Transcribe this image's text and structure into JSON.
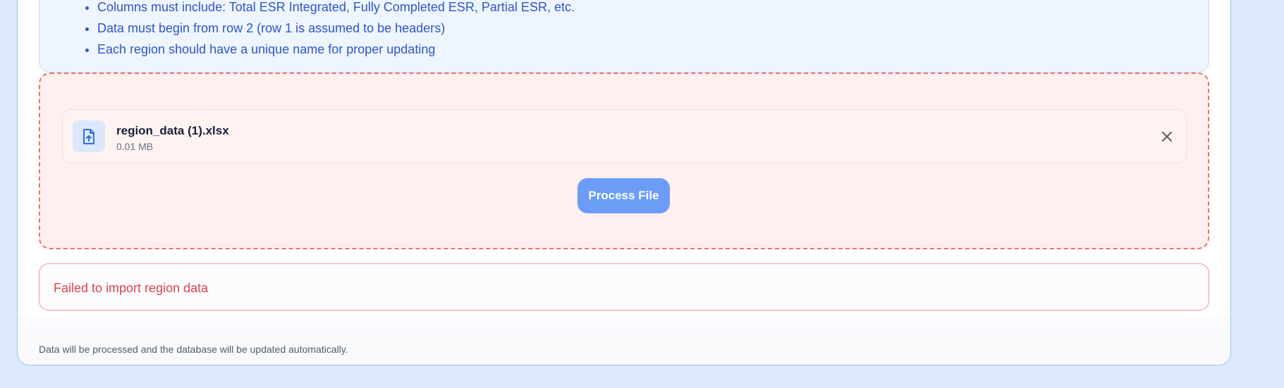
{
  "instructions": {
    "items": [
      "Columns must include: Total ESR Integrated, Fully Completed ESR, Partial ESR, etc.",
      "Data must begin from row 2 (row 1 is assumed to be headers)",
      "Each region should have a unique name for proper updating"
    ]
  },
  "upload": {
    "file_name": "region_data (1).xlsx",
    "file_size": "0.01 MB",
    "file_icon": "file-upload-icon",
    "remove_icon": "close-icon",
    "process_label": "Process File"
  },
  "error": {
    "message": "Failed to import region data"
  },
  "footer": {
    "note": "Data will be processed and the database will be updated automatically."
  },
  "colors": {
    "accent": "#6b9cf6",
    "error": "#e0434d",
    "dropzone_border": "#ee6f6f",
    "info_text": "#2f55c8"
  }
}
